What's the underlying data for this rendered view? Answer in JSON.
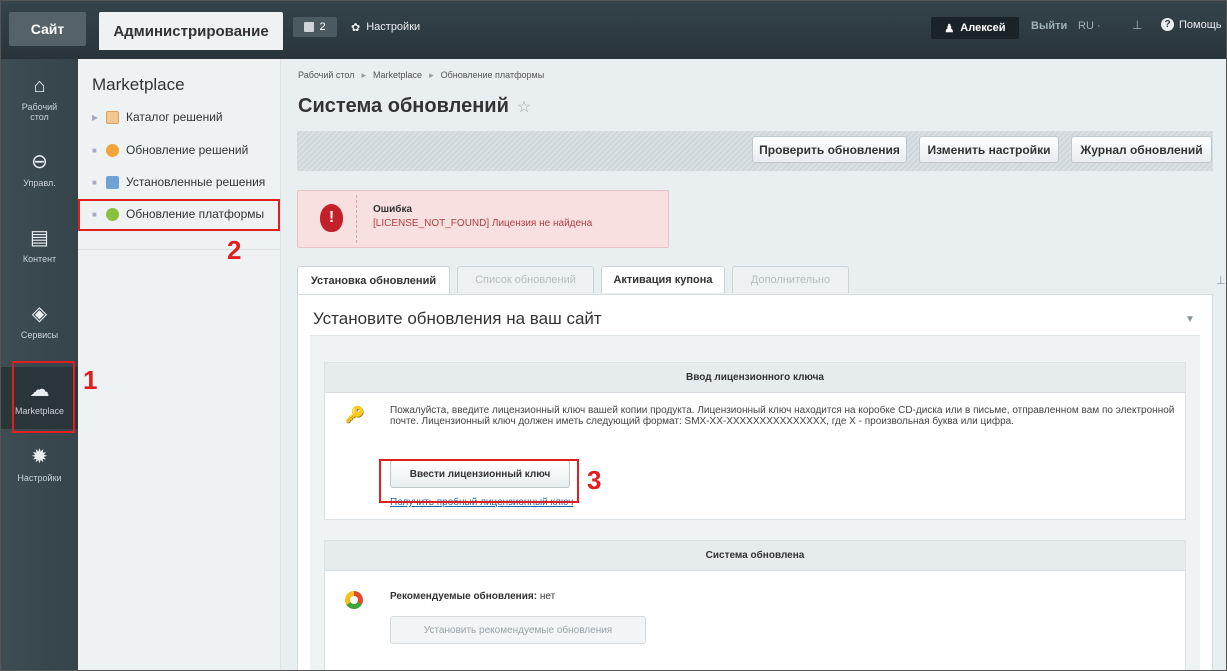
{
  "topbar": {
    "site_tab": "Сайт",
    "admin_tab": "Администрирование",
    "notifications_count": "2",
    "settings_label": "Настройки",
    "user_name": "Алексей",
    "logout_label": "Выйти",
    "lang_label": "RU ·",
    "help_label": "Помощь"
  },
  "iconbar": {
    "items": [
      {
        "label": "Рабочий стол",
        "icon": "home-icon"
      },
      {
        "label": "Управл.",
        "icon": "arrow-circle-icon"
      },
      {
        "label": "Контент",
        "icon": "document-icon"
      },
      {
        "label": "Сервисы",
        "icon": "layers-icon"
      },
      {
        "label": "Marketplace",
        "icon": "cloud-download-icon"
      },
      {
        "label": "Настройки",
        "icon": "gear-icon"
      }
    ]
  },
  "menu": {
    "title": "Marketplace",
    "items": [
      {
        "label": "Каталог решений"
      },
      {
        "label": "Обновление решений"
      },
      {
        "label": "Установленные решения"
      },
      {
        "label": "Обновление платформы"
      }
    ]
  },
  "annotations": {
    "n1": "1",
    "n2": "2",
    "n3": "3"
  },
  "breadcrumbs": [
    "Рабочий стол",
    "Marketplace",
    "Обновление платформы"
  ],
  "page_title": "Система обновлений",
  "toolbar": {
    "check_updates": "Проверить обновления",
    "change_settings": "Изменить настройки",
    "update_log": "Журнал обновлений"
  },
  "error": {
    "title": "Ошибка",
    "message": "[LICENSE_NOT_FOUND] Лицензия не найдена"
  },
  "tabs": [
    {
      "label": "Установка обновлений"
    },
    {
      "label": "Список обновлений"
    },
    {
      "label": "Активация купона"
    },
    {
      "label": "Дополнительно"
    }
  ],
  "panel": {
    "heading": "Установите обновления на ваш сайт",
    "license_box": {
      "header": "Ввод лицензионного ключа",
      "text": "Пожалуйста, введите лицензионный ключ вашей копии продукта. Лицензионный ключ находится на коробке CD-диска или в письме, отправленном вам по электронной почте. Лицензионный ключ должен иметь следующий формат: SMX-XX-XXXXXXXXXXXXXXX, где X - произвольная буква или цифра.",
      "button": "Ввести лицензионный ключ",
      "link": "Получить пробный лицензионный ключ"
    },
    "updated_box": {
      "header": "Система обновлена",
      "recommended_label": "Рекомендуемые обновления:",
      "recommended_value": "нет",
      "install_button": "Установить рекомендуемые обновления"
    }
  },
  "colors": {
    "annotation_red": "#e02020",
    "error_bg": "#f8dfe0",
    "link": "#2067b0"
  }
}
